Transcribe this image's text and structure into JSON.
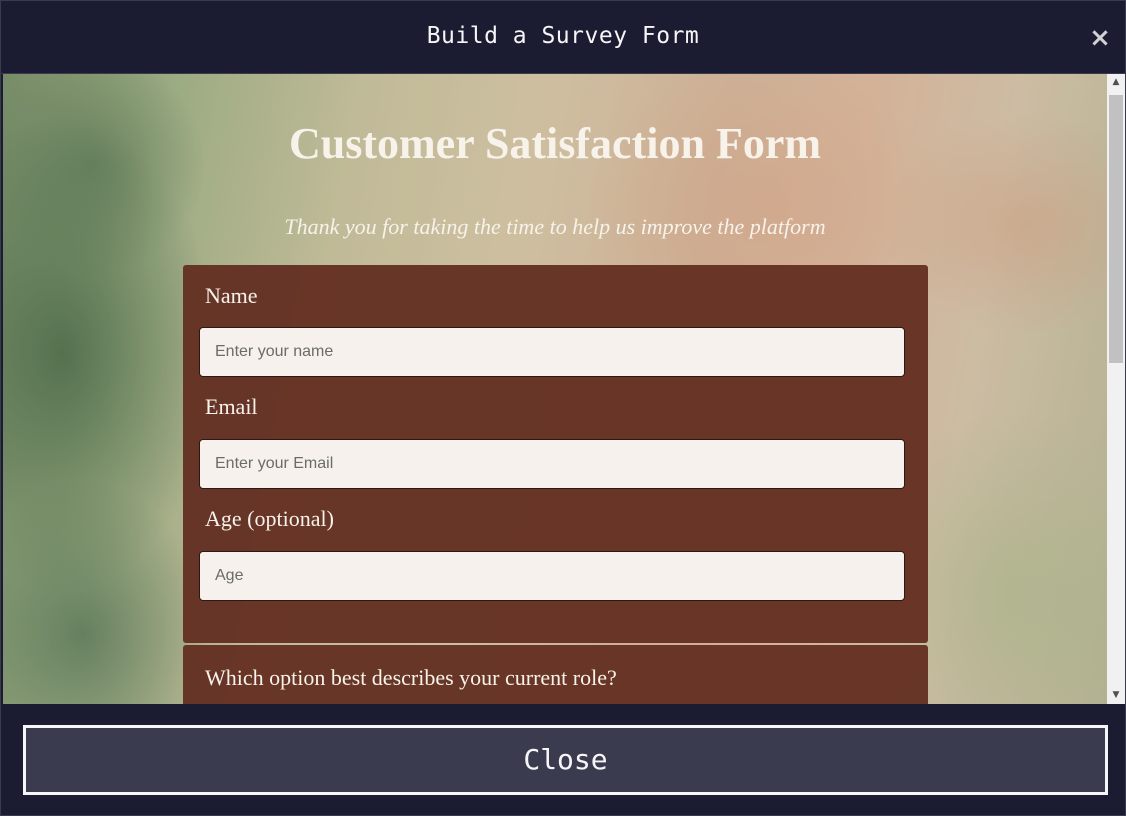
{
  "modal": {
    "title": "Build a Survey Form",
    "close_icon": "close-icon",
    "close_glyph": "×",
    "close_button_label": "Close"
  },
  "preview": {
    "title": "Customer Satisfaction Form",
    "description": "Thank you for taking the time to help us improve the platform",
    "fields": [
      {
        "label": "Name",
        "placeholder": "Enter your name"
      },
      {
        "label": "Email",
        "placeholder": "Enter your Email"
      },
      {
        "label": "Age (optional)",
        "placeholder": "Age"
      }
    ],
    "question": "Which option best describes your current role?"
  },
  "scrollbar": {
    "up_glyph": "▲",
    "down_glyph": "▼"
  }
}
